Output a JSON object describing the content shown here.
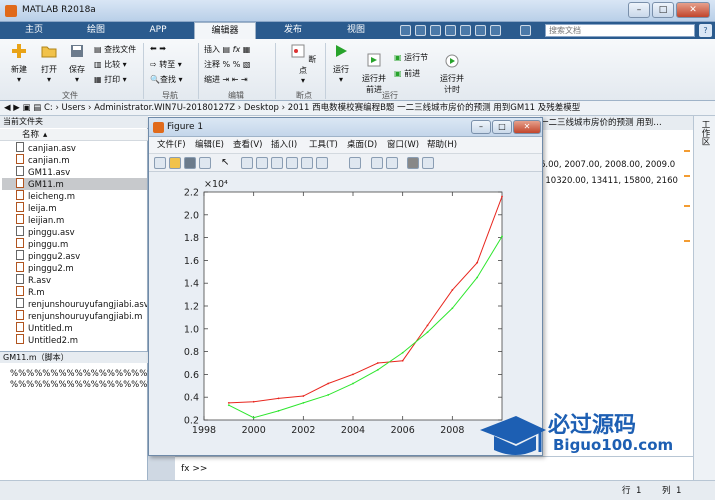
{
  "window": {
    "title": "MATLAB R2018a",
    "min": "–",
    "max": "□",
    "close": "✕"
  },
  "tabs": [
    "主页",
    "绘图",
    "APP",
    "编辑器",
    "发布",
    "视图"
  ],
  "search_placeholder": "搜索文档",
  "help": "?",
  "ribbon": {
    "new": "新建",
    "open": "打开",
    "save": "保存",
    "find_files": "查找文件",
    "compare": "比较",
    "print": "打印",
    "goto": "转至",
    "find": "查找",
    "insert": "插入",
    "comment": "注释",
    "indent": "缩进",
    "breakpoint": "断点",
    "run": "运行",
    "run_advance": "运行并\n前进",
    "run_section": "运行节",
    "advance": "前进",
    "run_time": "运行并\n计时",
    "groups": {
      "file": "文件",
      "nav": "导航",
      "edit": "编辑",
      "breakpoint": "断点",
      "run": "运行"
    }
  },
  "address": {
    "path": "C: › Users › Administrator.WIN7U-20180127Z › Desktop › 2011 西电数模校赛编程B题 一二三线城市房价的预测 用到GM11 及残差模型"
  },
  "filepanel": {
    "title": "当前文件夹",
    "column": "名称",
    "files": [
      "canjian.asv",
      "canjian.m",
      "GM11.asv",
      "GM11.m",
      "leicheng.m",
      "leija.m",
      "leijian.m",
      "pinggu.asv",
      "pinggu.m",
      "pinggu2.asv",
      "pinggu2.m",
      "R.asv",
      "R.m",
      "renjunshouruyufangjiabi.asv",
      "renjunshouruyufangjiabi.m",
      "Untitled.m",
      "Untitled2.m"
    ],
    "selected": "GM11.m"
  },
  "detail": {
    "header": "GM11.m（脚本）",
    "lines": [
      "%%%%%%%%%%%%%%%%%%%%%%",
      "%%%%%%%%%%%%%%%%%%%%%%"
    ]
  },
  "editor": {
    "tab": "一二三线城市房价的预测 用到…",
    "line1": "6.00, 2007.00, 2008.00, 2009.0",
    "line2": ", 10320.00, 13411, 15800, 2160"
  },
  "right_strip_label": "工作区",
  "command": {
    "prompt": "fx >>"
  },
  "status": {
    "row_label": "行",
    "row": "1",
    "col_label": "列",
    "col": "1"
  },
  "figure": {
    "title": "Figure 1",
    "menu": [
      "文件(F)",
      "编辑(E)",
      "查看(V)",
      "插入(I)",
      "工具(T)",
      "桌面(D)",
      "窗口(W)",
      "帮助(H)"
    ]
  },
  "chart_data": {
    "type": "line",
    "title": "",
    "xlabel": "",
    "ylabel": "",
    "y_exponent": "×10⁴",
    "xlim": [
      1998,
      2010
    ],
    "ylim": [
      0.2,
      2.2
    ],
    "xticks": [
      1998,
      2000,
      2002,
      2004,
      2006,
      2008
    ],
    "yticks": [
      0.2,
      0.4,
      0.6,
      0.8,
      1.0,
      1.2,
      1.4,
      1.6,
      1.8,
      2.0,
      2.2
    ],
    "grid": false,
    "series": [
      {
        "color": "#e8261e",
        "x": [
          1999,
          2000,
          2001,
          2002,
          2003,
          2004,
          2005,
          2006,
          2007,
          2008,
          2009,
          2010
        ],
        "y": [
          0.35,
          0.36,
          0.39,
          0.41,
          0.52,
          0.6,
          0.7,
          0.72,
          1.03,
          1.34,
          1.58,
          2.16
        ]
      },
      {
        "color": "#2ee62e",
        "x": [
          1999,
          2000,
          2001,
          2002,
          2003,
          2004,
          2005,
          2006,
          2007,
          2008,
          2009,
          2010
        ],
        "y": [
          0.33,
          0.22,
          0.28,
          0.35,
          0.42,
          0.52,
          0.64,
          0.79,
          0.97,
          1.18,
          1.45,
          1.81
        ]
      }
    ]
  },
  "watermark": {
    "title": "必过源码",
    "url": "Biguo100.com"
  }
}
